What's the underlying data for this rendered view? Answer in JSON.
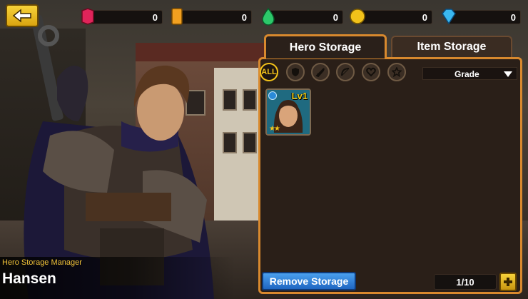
{
  "header": {
    "back_icon": "arrow-left-icon",
    "resources": [
      {
        "icon": "red-gem-icon",
        "value": "0",
        "color": "#e0245a"
      },
      {
        "icon": "orange-ticket-icon",
        "value": "0",
        "color": "#f2a020"
      },
      {
        "icon": "green-potion-icon",
        "value": "0",
        "color": "#2cc86a"
      },
      {
        "icon": "gold-coin-icon",
        "value": "0",
        "color": "#f2c21a"
      },
      {
        "icon": "diamond-icon",
        "value": "0",
        "color": "#3ab8f0"
      }
    ]
  },
  "tabs": {
    "hero_storage": "Hero Storage",
    "item_storage": "Item Storage",
    "active": "hero_storage"
  },
  "filters": {
    "all_label": "ALL",
    "icons": [
      "shield-icon",
      "sword-icon",
      "bow-icon",
      "heart-icon",
      "star-icon"
    ],
    "sort_selected": "Grade"
  },
  "heroes": [
    {
      "level_label": "Lv1",
      "stars": 2,
      "portrait": "female-hero-portrait"
    }
  ],
  "footer": {
    "remove_label": "Remove Storage",
    "count": "1/10",
    "plus_icon": "plus-icon"
  },
  "manager": {
    "title": "Hero Storage Manager",
    "name": "Hansen"
  },
  "colors": {
    "accent": "#d8892e",
    "button_blue": "#2a7ad8",
    "gold": "#f2c21a"
  }
}
